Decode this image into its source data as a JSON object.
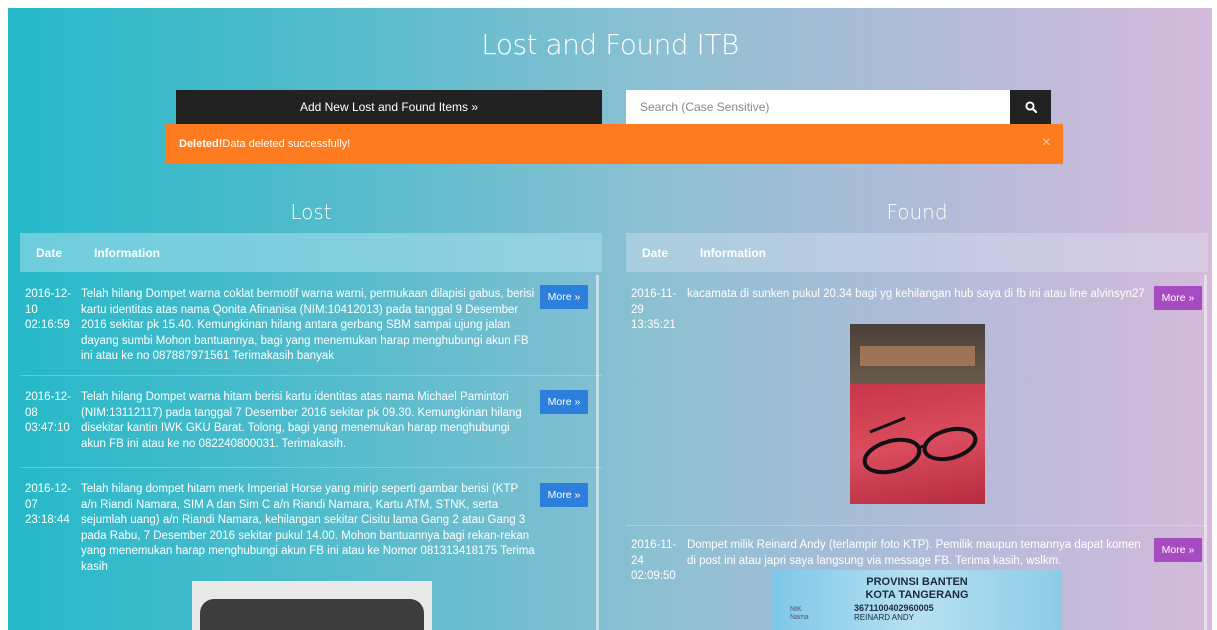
{
  "header": {
    "title": "Lost and Found ITB"
  },
  "toolbar": {
    "add_label": "Add New Lost and Found Items »",
    "search_placeholder": "Search (Case Sensitive)"
  },
  "alert": {
    "strong": "Deleted!",
    "message": "Data deleted successfully!",
    "close": "×"
  },
  "lost": {
    "title": "Lost",
    "columns": {
      "date": "Date",
      "info": "Information"
    },
    "rows": [
      {
        "date": "2016-12-10 02:16:59",
        "info": "Telah hilang Dompet warna coklat bermotif warna warni, permukaan dilapisi gabus, berisi kartu identitas atas nama Qonita Afinanisa (NIM:10412013) pada tanggal 9 Desember 2016 sekitar pk 15.40. Kemungkinan hilang antara gerbang SBM sampai ujung jalan dayang sumbi Mohon bantuannya, bagi yang menemukan harap menghubungi akun FB ini atau ke no 087887971561 Terimakasih banyak",
        "more": "More »"
      },
      {
        "date": "2016-12-08 03:47:10",
        "info": "Telah hilang Dompet warna hitam berisi kartu identitas atas nama Michael Pamintori (NIM:13112117) pada tanggal 7 Desember 2016 sekitar pk 09.30. Kemungkinan hilang disekitar kantin IWK GKU Barat. Tolong, bagi yang menemukan harap menghubungi akun FB ini atau ke no 082240800031. Terimakasih.",
        "more": "More »"
      },
      {
        "date": "2016-12-07 23:18:44",
        "info": "Telah hilang dompet hitam merk Imperial Horse yang mirip seperti gambar berisi (KTP a/n Riandi Namara, SIM A dan Sim C a/n Riandi Namara, Kartu ATM, STNK, serta sejumlah uang) a/n Riandi Namara, kehilangan sekitar Cisitu lama Gang 2 atau Gang 3 pada Rabu, 7 Desember 2016 sekitar pukul 14.00. Mohon bantuannya bagi rekan-rekan yang menemukan harap menghubungi akun FB ini atau ke Nomor 081313418175 Terima kasih",
        "more": "More »"
      }
    ]
  },
  "found": {
    "title": "Found",
    "columns": {
      "date": "Date",
      "info": "Information"
    },
    "rows": [
      {
        "date": "2016-11-29 13:35:21",
        "info": "kacamata di sunken pukul 20.34 bagi yg kehilangan hub saya di fb ini atau line alvinsyn27",
        "more": "More »"
      },
      {
        "date": "2016-11-24 02:09:50",
        "info": "Dompet milik Reinard Andy (terlampir foto KTP). Pemilik maupun temannya dapat komen di post ini atau japri saya langsung via message FB. Terima kasih, wslkm.",
        "more": "More »"
      }
    ],
    "ktp": {
      "province": "PROVINSI BANTEN",
      "city": "KOTA TANGERANG",
      "nik_label": "NIK",
      "nik": "3671100402960005",
      "nama_label": "Nama",
      "nama": "REINARD ANDY"
    }
  },
  "icons": {
    "search": "search-icon",
    "close": "close-icon"
  },
  "colors": {
    "add_button": "#222222",
    "alert": "#fe7b1f",
    "lost_more": "#2c7fdb",
    "found_more": "#a64bc0"
  }
}
